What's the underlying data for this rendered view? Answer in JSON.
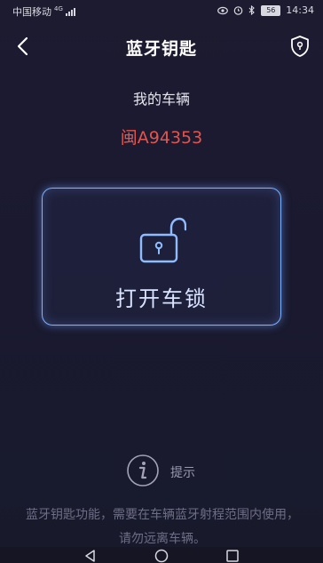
{
  "status_bar": {
    "carrier": "中国移动",
    "network": "4G",
    "battery": "56",
    "time": "14:34"
  },
  "header": {
    "title": "蓝牙钥匙"
  },
  "vehicle": {
    "label": "我的车辆",
    "plate": "闽A94353"
  },
  "unlock": {
    "label": "打开车锁"
  },
  "tip": {
    "label": "提示",
    "text": "蓝牙钥匙功能，需要在车辆蓝牙射程范围内使用，请勿远离车辆。"
  },
  "colors": {
    "background": "#1c1a2e",
    "plate": "#e0564e",
    "card_border": "#7fb2ff",
    "unlock_text": "#d8e4ff"
  },
  "icons": [
    "back-arrow-icon",
    "shield-icon",
    "unlocked-padlock-icon",
    "info-icon",
    "nav-back-icon",
    "nav-home-icon",
    "nav-recent-icon"
  ]
}
